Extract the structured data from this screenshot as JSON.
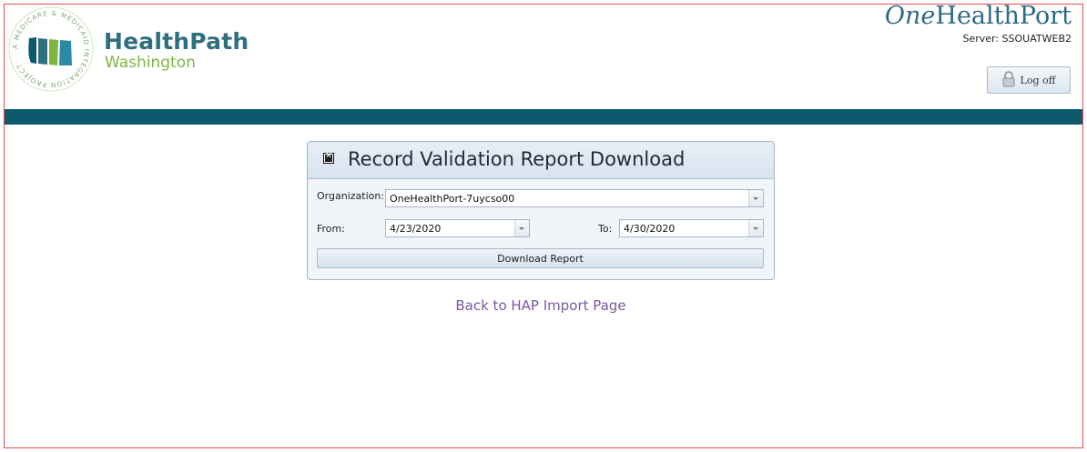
{
  "header": {
    "brand_name": "HealthPath",
    "brand_sub": "Washington",
    "seal_text": "A MEDICARE & MEDICAID INTEGRATION PROJECT",
    "partner_logo_one": "One",
    "partner_logo_rest": "HealthPort",
    "server_label": "Server: SSOUATWEB2",
    "logoff_label": "Log off",
    "colors": {
      "brand_teal": "#2e6f80",
      "brand_green": "#7fb541",
      "band": "#0d5a6f"
    }
  },
  "panel": {
    "title": "Record Validation Report Download",
    "close_icon": "close-icon",
    "organization_label": "Organization:",
    "organization_value": "OneHealthPort-7uycso00",
    "from_label": "From:",
    "from_value": "4/23/2020",
    "to_label": "To:",
    "to_value": "4/30/2020",
    "download_label": "Download Report"
  },
  "back_link": "Back to HAP Import Page"
}
